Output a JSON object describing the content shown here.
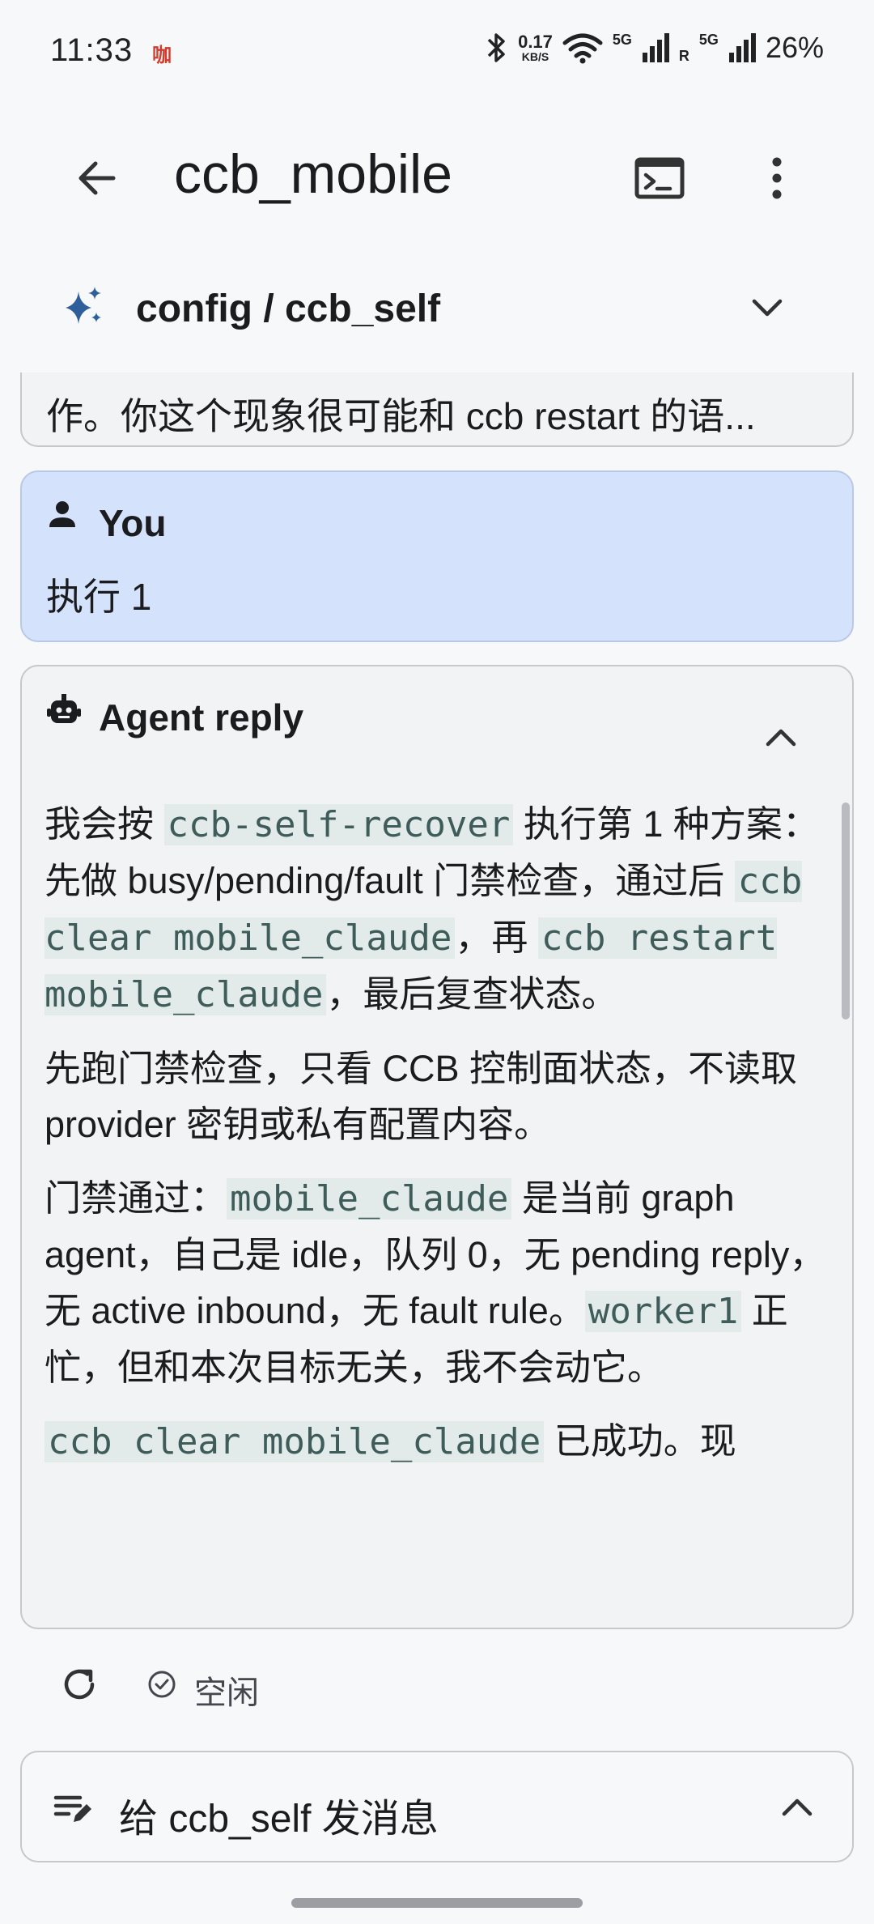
{
  "status_bar": {
    "time": "11:33",
    "notification_app": "咖",
    "net_speed_value": "0.17",
    "net_speed_unit": "KB/S",
    "sig1_label": "5G",
    "sig2_label": "5G",
    "roaming": "R",
    "battery": "26%"
  },
  "app_bar": {
    "title": "ccb_mobile"
  },
  "session": {
    "label": "config / ccb_self"
  },
  "chat": {
    "previous_snippet": "作。你这个现象很可能和 ccb restart 的语...",
    "user": {
      "name": "You",
      "message": "执行 1"
    },
    "agent": {
      "name": "Agent reply",
      "p1": {
        "t1": "我会按 ",
        "c1": "ccb-self-recover",
        "t2": " 执行第 1 种方案：先做 busy/pending/fault 门禁检查，通过后 ",
        "c2": "ccb clear mobile_claude",
        "t3": "，再 ",
        "c3": "ccb restart mobile_claude",
        "t4": "，最后复查状态。"
      },
      "p2": "先跑门禁检查，只看 CCB 控制面状态，不读取 provider 密钥或私有配置内容。",
      "p3": {
        "t1": "门禁通过：",
        "c1": "mobile_claude",
        "t2": " 是当前 graph agent，自己是 idle，队列 0，无 pending reply，无 active inbound，无 fault rule。",
        "c2": "worker1",
        "t3": " 正忙，但和本次目标无关，我不会动它。"
      },
      "p4": {
        "c1": "ccb clear mobile_claude",
        "t1": " 已成功。现"
      }
    }
  },
  "status_row": {
    "state": "空闲"
  },
  "composer": {
    "label": "给 ccb_self 发消息"
  }
}
